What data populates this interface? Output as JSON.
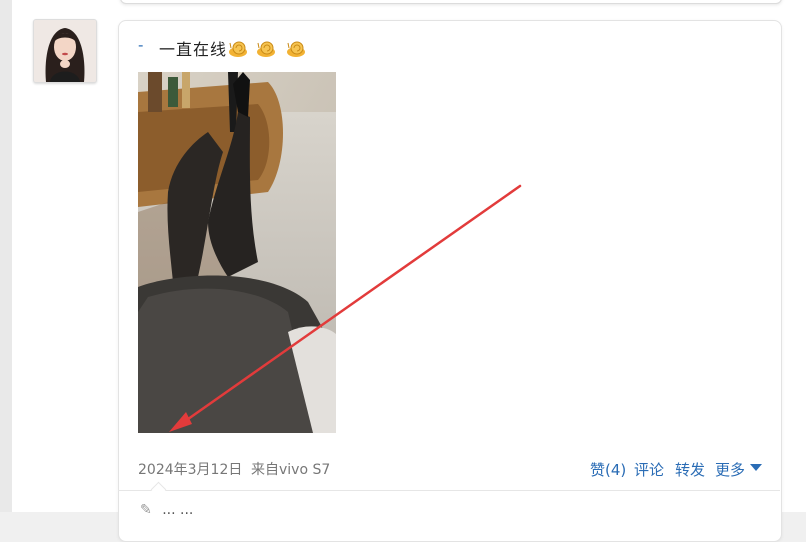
{
  "post": {
    "dash": "-",
    "text": "一直在线",
    "emojis": [
      "snail-emoji",
      "snail-emoji",
      "snail-emoji"
    ]
  },
  "meta": {
    "date": "2024年3月12日",
    "source": "来自vivo S7"
  },
  "actions": {
    "like": "赞(4)",
    "comment": "评论",
    "forward": "转发",
    "more": "更多"
  },
  "comment_peek": {
    "icon": "comment-icon",
    "text": "...  ..."
  },
  "colors": {
    "link": "#2a6cb5",
    "arrow": "#e23b3b"
  }
}
